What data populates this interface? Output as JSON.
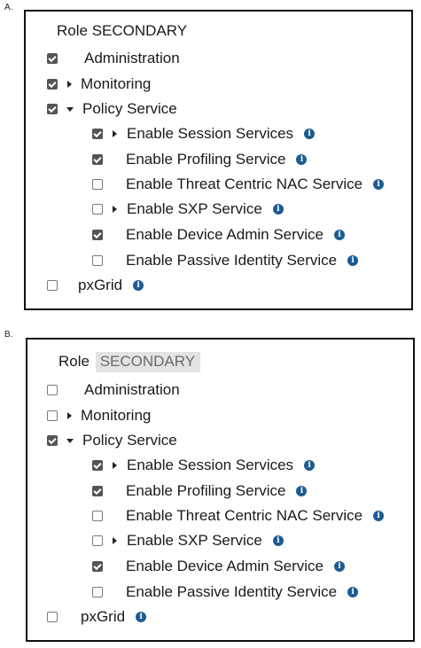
{
  "options": [
    {
      "letter": "A.",
      "role_label": "Role",
      "role_value": "SECONDARY",
      "items": [
        {
          "label": "Administration",
          "checked": true,
          "expander": "none",
          "info": false
        },
        {
          "label": "Monitoring",
          "checked": true,
          "expander": "collapsed",
          "info": false
        },
        {
          "label": "Policy Service",
          "checked": true,
          "expander": "expanded",
          "info": false
        },
        {
          "label": "Enable Session Services",
          "checked": true,
          "expander": "collapsed",
          "info": true
        },
        {
          "label": "Enable Profiling Service",
          "checked": true,
          "expander": "none",
          "info": true
        },
        {
          "label": "Enable Threat Centric NAC Service",
          "checked": false,
          "expander": "none",
          "info": true
        },
        {
          "label": "Enable SXP Service",
          "checked": false,
          "expander": "collapsed",
          "info": true
        },
        {
          "label": "Enable Device Admin Service",
          "checked": true,
          "expander": "none",
          "info": true
        },
        {
          "label": "Enable Passive Identity Service",
          "checked": false,
          "expander": "none",
          "info": true
        },
        {
          "label": "pxGrid",
          "checked": false,
          "expander": "none",
          "info": true
        }
      ]
    },
    {
      "letter": "B.",
      "role_label": "Role",
      "role_value": "SECONDARY",
      "items": [
        {
          "label": "Administration",
          "checked": false,
          "expander": "none",
          "info": false
        },
        {
          "label": "Monitoring",
          "checked": false,
          "expander": "collapsed",
          "info": false
        },
        {
          "label": "Policy Service",
          "checked": true,
          "expander": "expanded",
          "info": false
        },
        {
          "label": "Enable Session Services",
          "checked": true,
          "expander": "collapsed",
          "info": true
        },
        {
          "label": "Enable Profiling Service",
          "checked": true,
          "expander": "none",
          "info": true
        },
        {
          "label": "Enable Threat Centric NAC Service",
          "checked": false,
          "expander": "none",
          "info": true
        },
        {
          "label": "Enable SXP Service",
          "checked": false,
          "expander": "collapsed",
          "info": true
        },
        {
          "label": "Enable Device Admin Service",
          "checked": true,
          "expander": "none",
          "info": true
        },
        {
          "label": "Enable Passive Identity Service",
          "checked": false,
          "expander": "none",
          "info": true
        },
        {
          "label": "pxGrid",
          "checked": false,
          "expander": "none",
          "info": true
        }
      ]
    }
  ],
  "info_glyph": "i",
  "icons": {
    "checkbox": "checkbox-icon",
    "expand": "caret-right-icon",
    "collapse": "caret-down-icon",
    "info": "info-icon"
  }
}
